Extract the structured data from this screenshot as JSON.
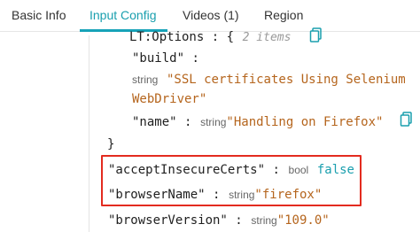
{
  "tabs": [
    {
      "label": "Basic Info",
      "active": false
    },
    {
      "label": "Input Config",
      "active": true
    },
    {
      "label": "Videos (1)",
      "active": false
    },
    {
      "label": "Region",
      "active": false
    }
  ],
  "tree": {
    "lt_options": {
      "key": "LT:Options",
      "separator": " : {",
      "meta": "2 items"
    },
    "build": {
      "key": "\"build\"",
      "separator": " :",
      "type": "string",
      "value_line1": "\"SSL certificates Using Selenium",
      "value_line2": "WebDriver\""
    },
    "name": {
      "key": "\"name\"",
      "separator": " :",
      "type": "string",
      "value": "\"Handling on Firefox\""
    },
    "close_brace": "}",
    "accept_insecure": {
      "key": "\"acceptInsecureCerts\"",
      "separator": " :",
      "type": "bool",
      "value": "false"
    },
    "browser_name": {
      "key": "\"browserName\"",
      "separator": " :",
      "type": "string",
      "value": "\"firefox\""
    },
    "browser_version": {
      "key": "\"browserVersion\"",
      "separator": " :",
      "type": "string",
      "value": "\"109.0\""
    }
  },
  "colors": {
    "accent": "#17a2b8",
    "string_value": "#b5651d",
    "highlight_box": "#e32b1f"
  },
  "icons": {
    "copy": "clipboard-copy-icon"
  }
}
